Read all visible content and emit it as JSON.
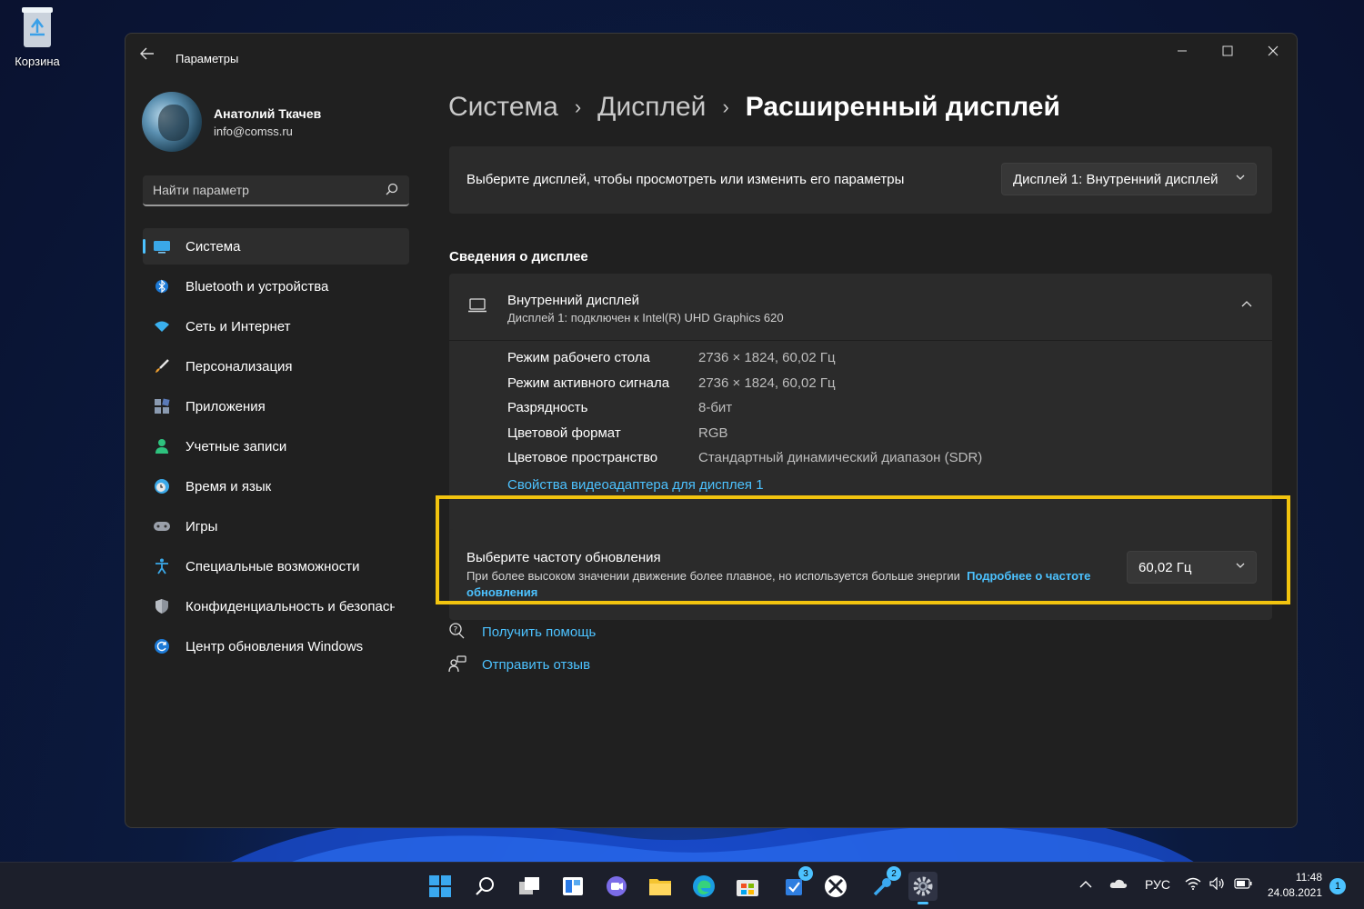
{
  "desktop": {
    "recycle_bin_label": "Корзина"
  },
  "window": {
    "title": "Параметры",
    "controls": {
      "minimize": "—",
      "maximize": "☐",
      "close": "✕"
    }
  },
  "profile": {
    "name": "Анатолий Ткачев",
    "email": "info@comss.ru"
  },
  "search": {
    "placeholder": "Найти параметр"
  },
  "nav": {
    "items": [
      {
        "label": "Система",
        "icon": "display-icon",
        "active": true
      },
      {
        "label": "Bluetooth и устройства",
        "icon": "bluetooth-icon"
      },
      {
        "label": "Сеть и Интернет",
        "icon": "wifi-icon"
      },
      {
        "label": "Персонализация",
        "icon": "brush-icon"
      },
      {
        "label": "Приложения",
        "icon": "apps-icon"
      },
      {
        "label": "Учетные записи",
        "icon": "person-icon"
      },
      {
        "label": "Время и язык",
        "icon": "clock-globe-icon"
      },
      {
        "label": "Игры",
        "icon": "gamepad-icon"
      },
      {
        "label": "Специальные возможности",
        "icon": "accessibility-icon"
      },
      {
        "label": "Конфиденциальность и безопасность",
        "icon": "shield-icon"
      },
      {
        "label": "Центр обновления Windows",
        "icon": "update-icon"
      }
    ]
  },
  "breadcrumb": {
    "items": [
      "Система",
      "Дисплей",
      "Расширенный дисплей"
    ],
    "separator": "›"
  },
  "display_select": {
    "text": "Выберите дисплей, чтобы просмотреть или изменить его параметры",
    "value": "Дисплей 1: Внутренний дисплей"
  },
  "display_info": {
    "section_title": "Сведения о дисплее",
    "title": "Внутренний дисплей",
    "subtitle": "Дисплей 1: подключен к Intel(R) UHD Graphics 620",
    "rows": [
      {
        "key": "Режим рабочего стола",
        "value": "2736 × 1824, 60,02 Гц"
      },
      {
        "key": "Режим активного сигнала",
        "value": "2736 × 1824, 60,02 Гц"
      },
      {
        "key": "Разрядность",
        "value": "8-бит"
      },
      {
        "key": "Цветовой формат",
        "value": "RGB"
      },
      {
        "key": "Цветовое пространство",
        "value": "Стандартный динамический диапазон (SDR)"
      }
    ],
    "adapter_link": "Свойства видеоадаптера для дисплея 1"
  },
  "refresh_rate": {
    "title": "Выберите частоту обновления",
    "description": "При более высоком значении движение более плавное, но используется больше энергии",
    "learn_more": "Подробнее о частоте обновления",
    "value": "60,02 Гц",
    "highlight_color": "#f2c40f"
  },
  "help": {
    "get_help": "Получить помощь",
    "feedback": "Отправить отзыв"
  },
  "taskbar": {
    "badges": {
      "todo": "3",
      "remote": "2"
    },
    "tray": {
      "language": "РУС"
    },
    "clock": {
      "time": "11:48",
      "date": "24.08.2021"
    },
    "notifications": "1"
  },
  "colors": {
    "accent": "#4cc2ff",
    "background": "#202020",
    "card": "#2b2b2b"
  }
}
